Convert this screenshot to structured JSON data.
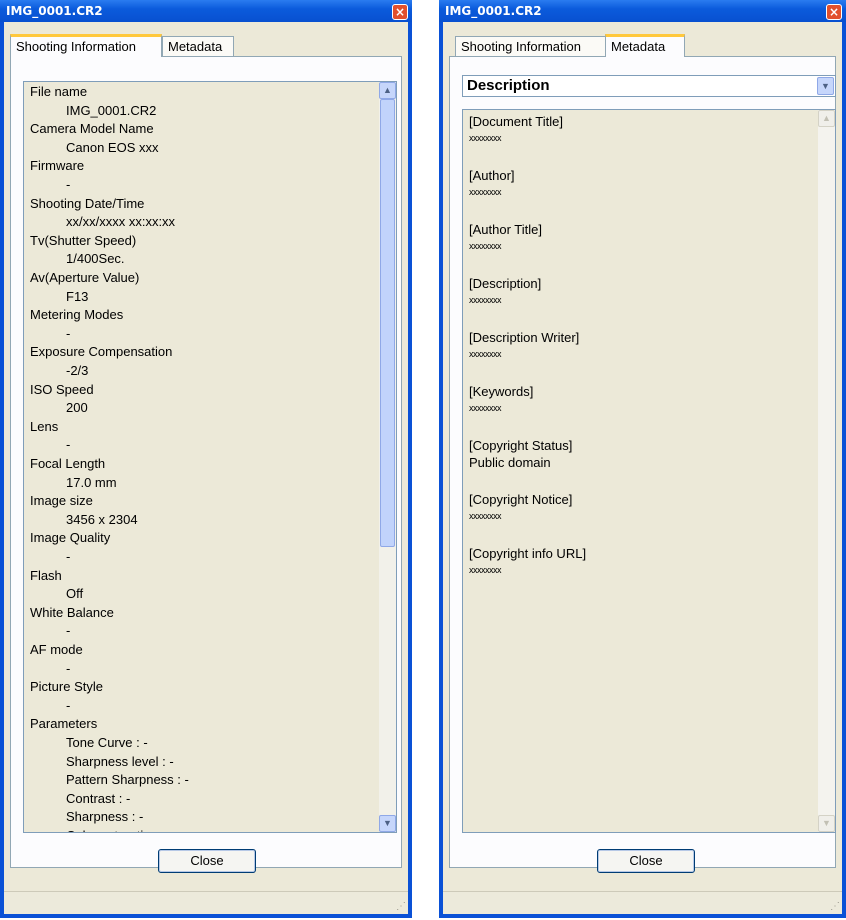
{
  "left_window": {
    "title": "IMG_0001.CR2",
    "tabs": [
      {
        "label": "Shooting Information",
        "active": true
      },
      {
        "label": "Metadata",
        "active": false
      }
    ],
    "fields": [
      {
        "label": "File name",
        "value": "IMG_0001.CR2"
      },
      {
        "label": "Camera Model Name",
        "value": "Canon EOS xxx"
      },
      {
        "label": "Firmware",
        "value": "-"
      },
      {
        "label": "Shooting Date/Time",
        "value": "xx/xx/xxxx  xx:xx:xx"
      },
      {
        "label": "Tv(Shutter Speed)",
        "value": "1/400Sec."
      },
      {
        "label": "Av(Aperture Value)",
        "value": "F13"
      },
      {
        "label": "Metering Modes",
        "value": "-"
      },
      {
        "label": "Exposure Compensation",
        "value": "-2/3"
      },
      {
        "label": "ISO Speed",
        "value": "200"
      },
      {
        "label": "Lens",
        "value": "-"
      },
      {
        "label": "Focal Length",
        "value": "17.0 mm"
      },
      {
        "label": "Image size",
        "value": "3456 x 2304"
      },
      {
        "label": "Image Quality",
        "value": "-"
      },
      {
        "label": "Flash",
        "value": "Off"
      },
      {
        "label": "White Balance",
        "value": "-"
      },
      {
        "label": "AF mode",
        "value": "-"
      },
      {
        "label": "Picture Style",
        "value": "-"
      }
    ],
    "parameters_label": "Parameters",
    "parameters": [
      "Tone Curve :  -",
      "Sharpness level :  -",
      "Pattern Sharpness :  -",
      "Contrast :  -",
      "Sharpness :  -",
      "Color saturation :  -"
    ],
    "close_label": "Close"
  },
  "right_window": {
    "title": "IMG_0001.CR2",
    "tabs": [
      {
        "label": "Shooting Information",
        "active": false
      },
      {
        "label": "Metadata",
        "active": true
      }
    ],
    "dropdown_value": "Description",
    "fields": [
      {
        "label": "[Document Title]",
        "value": "xxxxxxxx"
      },
      {
        "label": "[Author]",
        "value": "xxxxxxxx"
      },
      {
        "label": "[Author Title]",
        "value": "xxxxxxxx"
      },
      {
        "label": "[Description]",
        "value": "xxxxxxxx"
      },
      {
        "label": "[Description Writer]",
        "value": "xxxxxxxx"
      },
      {
        "label": "[Keywords]",
        "value": "xxxxxxxx"
      },
      {
        "label": "[Copyright Status]",
        "value": "Public domain"
      },
      {
        "label": "[Copyright Notice]",
        "value": "xxxxxxxx"
      },
      {
        "label": "[Copyright info URL]",
        "value": "xxxxxxxx"
      }
    ],
    "close_label": "Close"
  }
}
